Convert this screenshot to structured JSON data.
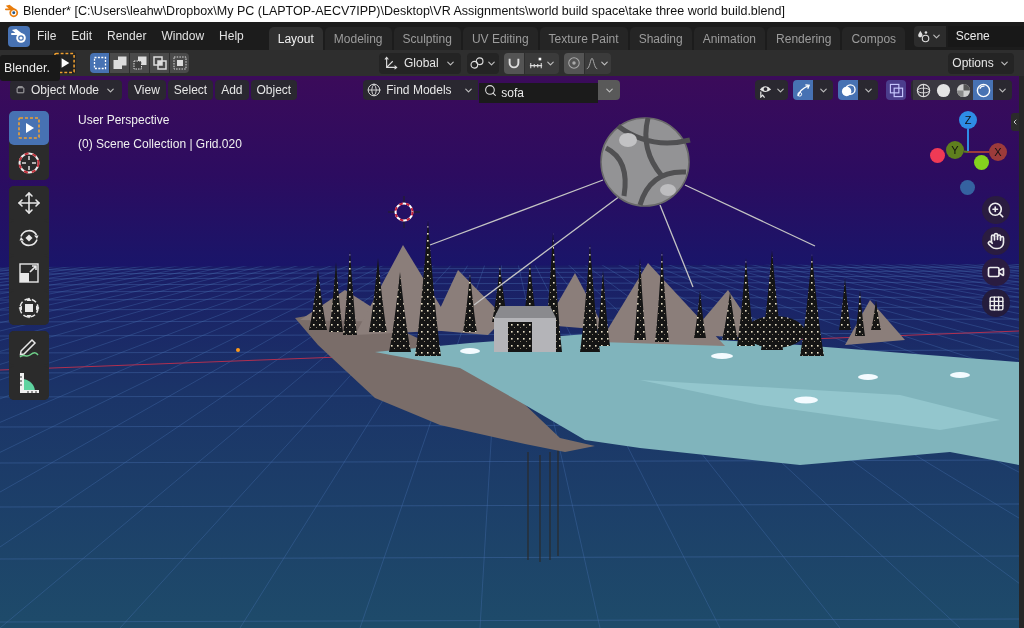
{
  "window": {
    "title": "Blender* [C:\\Users\\leahw\\Dropbox\\My PC (LAPTOP-AECV7IPP)\\Desktop\\VR Assignments\\world build space\\take three world build.blend]"
  },
  "top_bar": {
    "menus": [
      "File",
      "Edit",
      "Render",
      "Window",
      "Help"
    ],
    "workspace_tabs": [
      {
        "label": "Layout",
        "selected": true
      },
      {
        "label": "Modeling",
        "selected": false
      },
      {
        "label": "Sculpting",
        "selected": false
      },
      {
        "label": "UV Editing",
        "selected": false
      },
      {
        "label": "Texture Paint",
        "selected": false
      },
      {
        "label": "Shading",
        "selected": false
      },
      {
        "label": "Animation",
        "selected": false
      },
      {
        "label": "Rendering",
        "selected": false
      },
      {
        "label": "Compos",
        "selected": false
      }
    ],
    "scene": "Scene"
  },
  "tooltip": "Blender.",
  "tool_header": {
    "select_modes": [
      {
        "kind": "set",
        "selected": true
      },
      {
        "kind": "extend",
        "selected": false
      },
      {
        "kind": "subtract",
        "selected": false
      },
      {
        "kind": "difference",
        "selected": false
      },
      {
        "kind": "intersect",
        "selected": false
      }
    ],
    "orientation": "Global",
    "options": "Options"
  },
  "viewport_header": {
    "mode": "Object Mode",
    "menus": [
      "View",
      "Select",
      "Add",
      "Object"
    ],
    "find_models": "Find Models",
    "search": {
      "value": "sofa"
    },
    "toggles": [
      {
        "kind": "gizmos",
        "on": true
      },
      {
        "kind": "overlays",
        "on": true
      },
      {
        "kind": "xray",
        "on": false
      }
    ],
    "shading": [
      {
        "kind": "wireframe",
        "selected": false
      },
      {
        "kind": "solid",
        "selected": false
      },
      {
        "kind": "material",
        "selected": false
      },
      {
        "kind": "rendered",
        "selected": true
      }
    ]
  },
  "viewport": {
    "perspective": "User Perspective",
    "collection": "(0) Scene Collection | Grid.020",
    "tool_groups": [
      {
        "tools": [
          {
            "kind": "select_box",
            "selected": true
          },
          {
            "kind": "cursor",
            "selected": false
          }
        ]
      },
      {
        "tools": [
          {
            "kind": "move",
            "selected": false
          },
          {
            "kind": "rotate",
            "selected": false
          },
          {
            "kind": "scale",
            "selected": false
          },
          {
            "kind": "transform",
            "selected": false
          }
        ]
      },
      {
        "tools": [
          {
            "kind": "annotate",
            "selected": false
          },
          {
            "kind": "measure",
            "selected": false
          }
        ]
      }
    ],
    "axes": [
      {
        "label": "Z",
        "color": "#2e8de6"
      },
      {
        "label": "Y",
        "color": "#5f7f1e"
      },
      {
        "label": "X",
        "color": "#9c3b3b"
      },
      {
        "color": "#f03a55"
      },
      {
        "color": "#84d21e"
      },
      {
        "color": "#3562a0"
      }
    ]
  }
}
